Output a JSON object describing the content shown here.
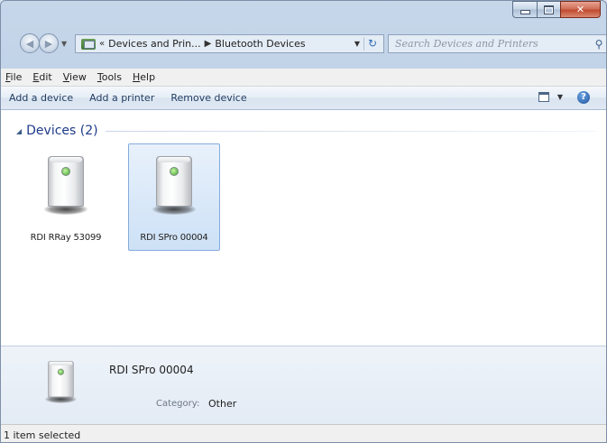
{
  "window": {
    "caption_buttons": [
      "minimize",
      "maximize",
      "close"
    ]
  },
  "address": {
    "overflow": "«",
    "crumbs": [
      "Devices and Prin...",
      "Bluetooth Devices"
    ],
    "search_placeholder": "Search Devices and Printers"
  },
  "menu": [
    {
      "label": "File",
      "accel": "F",
      "rest": "ile"
    },
    {
      "label": "Edit",
      "accel": "E",
      "rest": "dit"
    },
    {
      "label": "View",
      "accel": "V",
      "rest": "iew"
    },
    {
      "label": "Tools",
      "accel": "T",
      "rest": "ools"
    },
    {
      "label": "Help",
      "accel": "H",
      "rest": "elp"
    }
  ],
  "commands": {
    "add_device": "Add a device",
    "add_printer": "Add a printer",
    "remove_device": "Remove device",
    "help": "?"
  },
  "group": {
    "title": "Devices (2)"
  },
  "devices": [
    {
      "name": "RDI RRay 53099",
      "selected": false
    },
    {
      "name": "RDI SPro 00004",
      "selected": true
    }
  ],
  "details": {
    "name": "RDI SPro 00004",
    "category_label": "Category:",
    "category_value": "Other"
  },
  "status": {
    "text": "1 item selected"
  },
  "colors": {
    "accent": "#1e3a8a",
    "selection": "#cde1f6",
    "led": "#3aa52a",
    "close_button": "#c04a30"
  }
}
